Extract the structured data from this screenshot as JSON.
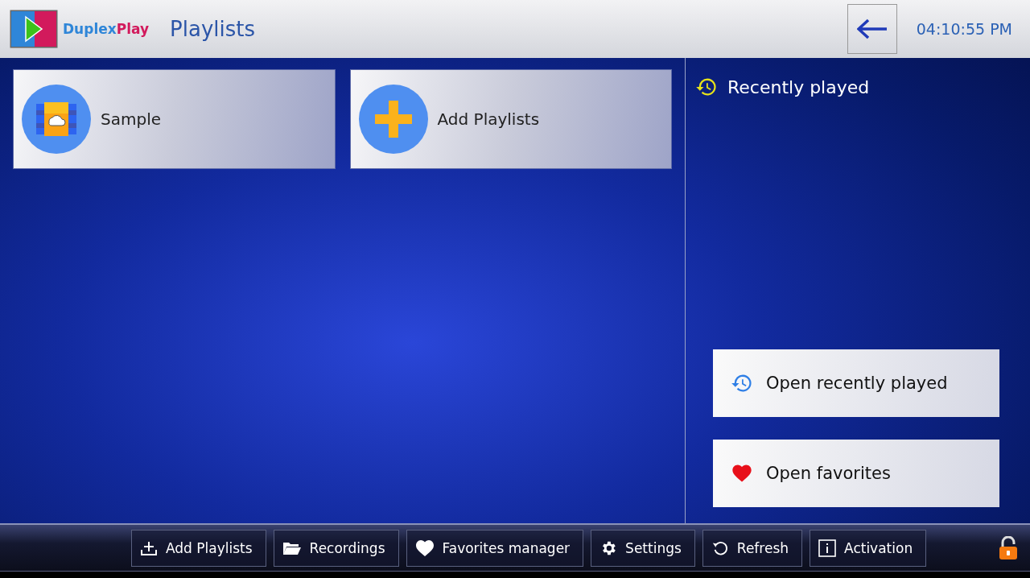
{
  "header": {
    "brand": [
      "Duplex",
      "Play"
    ],
    "title": "Playlists",
    "clock": "04:10:55 PM"
  },
  "tiles": [
    {
      "kind": "playlist",
      "label": "Sample"
    },
    {
      "kind": "add",
      "label": "Add Playlists"
    }
  ],
  "recent": {
    "title": "Recently played",
    "actions": [
      {
        "kind": "recent",
        "label": "Open recently played"
      },
      {
        "kind": "favorites",
        "label": "Open favorites"
      }
    ]
  },
  "toolbar": {
    "buttons": [
      {
        "kind": "add",
        "label": "Add Playlists"
      },
      {
        "kind": "folder",
        "label": "Recordings"
      },
      {
        "kind": "heart",
        "label": "Favorites manager"
      },
      {
        "kind": "gear",
        "label": "Settings"
      },
      {
        "kind": "refresh",
        "label": "Refresh"
      },
      {
        "kind": "info",
        "label": "Activation"
      }
    ],
    "locked": false
  }
}
